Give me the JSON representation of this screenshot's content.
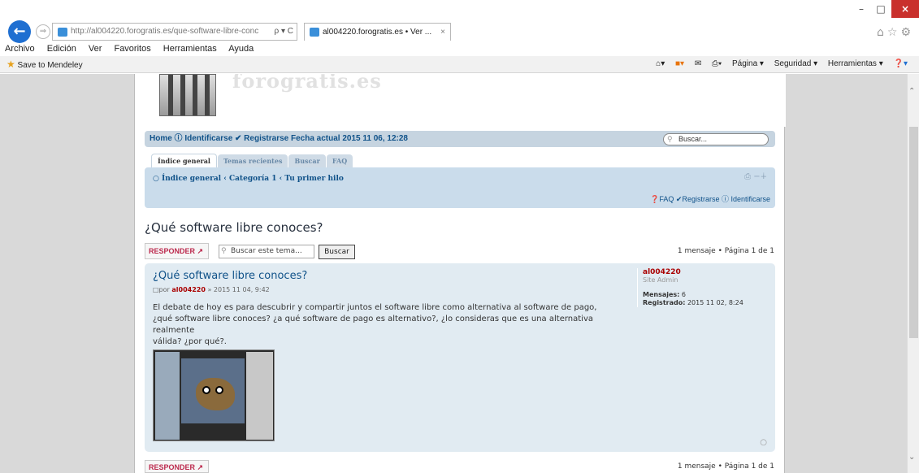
{
  "browser": {
    "address_url": "http://al004220.forogratis.es/que-software-libre-conc",
    "address_controls": "ρ ▾ C",
    "tab_title": "al004220.forogratis.es • Ver ...",
    "tab_close": "×",
    "window_min": "–",
    "window_max": "□",
    "window_close": "×",
    "right_icons": "⌂☆⚙"
  },
  "menu": [
    "Archivo",
    "Edición",
    "Ver",
    "Favoritos",
    "Herramientas",
    "Ayuda"
  ],
  "favorites": {
    "mendeley": "Save to Mendeley",
    "command_bar": [
      "Página ▾",
      "Seguridad ▾",
      "Herramientas ▾"
    ]
  },
  "forum": {
    "banner_text": "forogratis.es",
    "topnav_text": "Home ⓘ Identificarse ✔ Registrarse Fecha actual 2015 11 06, 12:28",
    "search_placeholder": "Buscar...",
    "tabs": [
      "Índice general",
      "Temas recientes",
      "Buscar",
      "FAQ"
    ],
    "breadcrumb": "○ Índice general ‹ Categoría 1 ‹ Tu primer hilo",
    "crumb_links": "❓FAQ ✔Registrarse ⓘ Identificarse",
    "topic_title": "¿Qué software libre conoces?",
    "reply_label": "RESPONDER ↗",
    "topic_search_placeholder": "Buscar este tema...",
    "search_button": "Buscar",
    "page_info": "1 mensaje • Página 1 de 1"
  },
  "post": {
    "title": "¿Qué software libre conoces?",
    "meta_prefix": "□por",
    "meta_author": "al004220",
    "meta_date": "» 2015 11 04, 9:42",
    "body_line1": "El debate de hoy es para descubrir y compartir juntos el software libre como alternativa al software de pago,",
    "body_line2": "¿qué software libre conoces? ¿a qué software de pago es alternativo?, ¿lo consideras que es una alternativa realmente",
    "body_line3": "válida? ¿por qué?.",
    "profile": {
      "username": "al004220",
      "rank": "Site Admin",
      "messages_label": "Mensajes:",
      "messages_value": "6",
      "registered_label": "Registrado:",
      "registered_value": "2015 11 02, 8:24"
    }
  }
}
